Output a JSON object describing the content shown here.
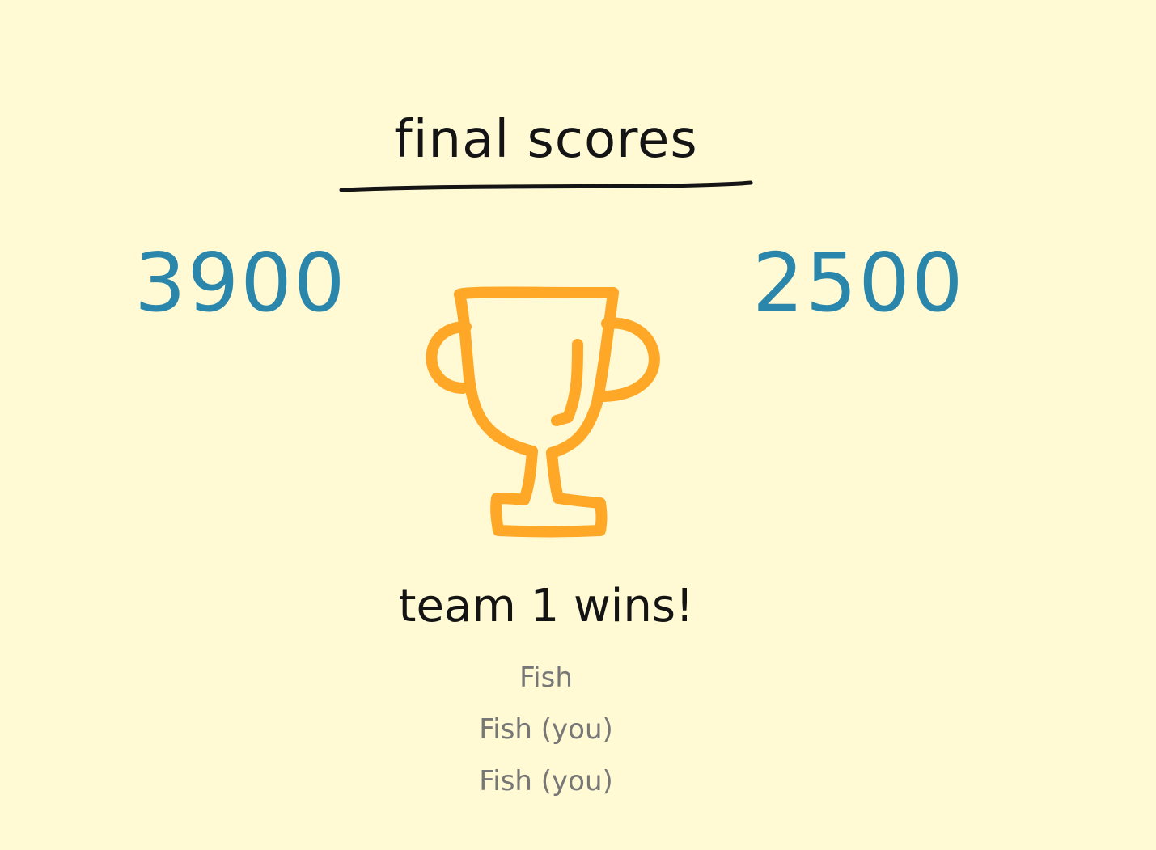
{
  "title": "final scores",
  "scores": {
    "team1": "3900",
    "team2": "2500"
  },
  "winner_text": "team 1 wins!",
  "players": [
    "Fish",
    "Fish (you)",
    "Fish (you)"
  ],
  "icons": {
    "trophy": "trophy-icon"
  },
  "colors": {
    "background": "#fff9d4",
    "score": "#2a86aa",
    "trophy": "#ffa726",
    "text": "#141414",
    "muted": "#777777"
  }
}
